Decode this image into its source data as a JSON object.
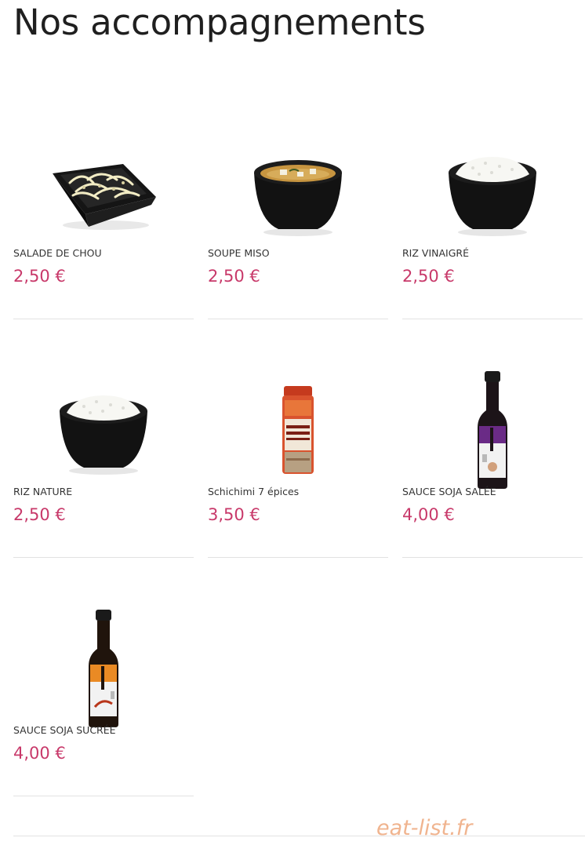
{
  "page": {
    "title": "Nos accompagnements",
    "watermark": "eat-list.fr"
  },
  "products": [
    {
      "name": "SALADE DE CHOU",
      "price": "2,50 €",
      "image": "cabbage-salad-bowl"
    },
    {
      "name": "SOUPE MISO",
      "price": "2,50 €",
      "image": "miso-soup-bowl"
    },
    {
      "name": "RIZ VINAIGRÉ",
      "price": "2,50 €",
      "image": "vinegared-rice-bowl"
    },
    {
      "name": "RIZ NATURE",
      "price": "2,50 €",
      "image": "plain-rice-bowl"
    },
    {
      "name": "Schichimi 7 épices",
      "price": "3,50 €",
      "image": "shichimi-spice-jar"
    },
    {
      "name": "SAUCE SOJA SALÉE",
      "price": "4,00 €",
      "image": "salted-soy-sauce-bottle"
    },
    {
      "name": "SAUCE SOJA SUCRÉE",
      "price": "4,00 €",
      "image": "sweet-soy-sauce-bottle"
    }
  ],
  "colors": {
    "price": "#c8396a",
    "title": "#1f1f1f",
    "divider": "#e2e2e2",
    "watermark": "#f0b48f"
  }
}
